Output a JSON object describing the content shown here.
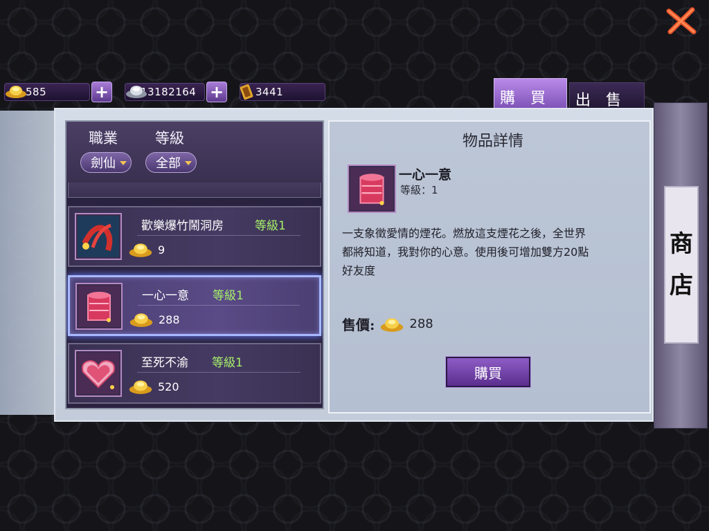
{
  "currencies": [
    {
      "icon": "gold-ingot-icon",
      "value": "585",
      "has_plus": true
    },
    {
      "icon": "silver-ingot-icon",
      "value": "13182164",
      "has_plus": true
    },
    {
      "icon": "gold-coupon-icon",
      "value": "3441",
      "has_plus": false
    }
  ],
  "tabs": {
    "buy": "購　買",
    "sell": "出　售"
  },
  "filters": {
    "job_label": "職業",
    "level_label": "等級",
    "job_value": "劍仙",
    "level_value": "全部"
  },
  "items": [
    {
      "name": "歡樂爆竹鬧洞房",
      "level": "等級1",
      "price": "9",
      "icon": "firecracker-icon"
    },
    {
      "name": "一心一意",
      "level": "等級1",
      "price": "288",
      "icon": "firework-box-icon"
    },
    {
      "name": "至死不渝",
      "level": "等級1",
      "price": "520",
      "icon": "heart-cake-icon"
    }
  ],
  "detail": {
    "title": "物品詳情",
    "name": "一心一意",
    "level": "等級：1",
    "desc_line1": "一支象徵愛情的煙花。燃放這支煙花之後，全世界",
    "desc_line2": "都將知道，我對你的心意。使用後可增加雙方20點",
    "desc_line3": "好友度",
    "price_label": "售價:",
    "price": "288",
    "buy_label": "購買"
  },
  "shop_sign": {
    "char1": "商",
    "char2": "店"
  }
}
